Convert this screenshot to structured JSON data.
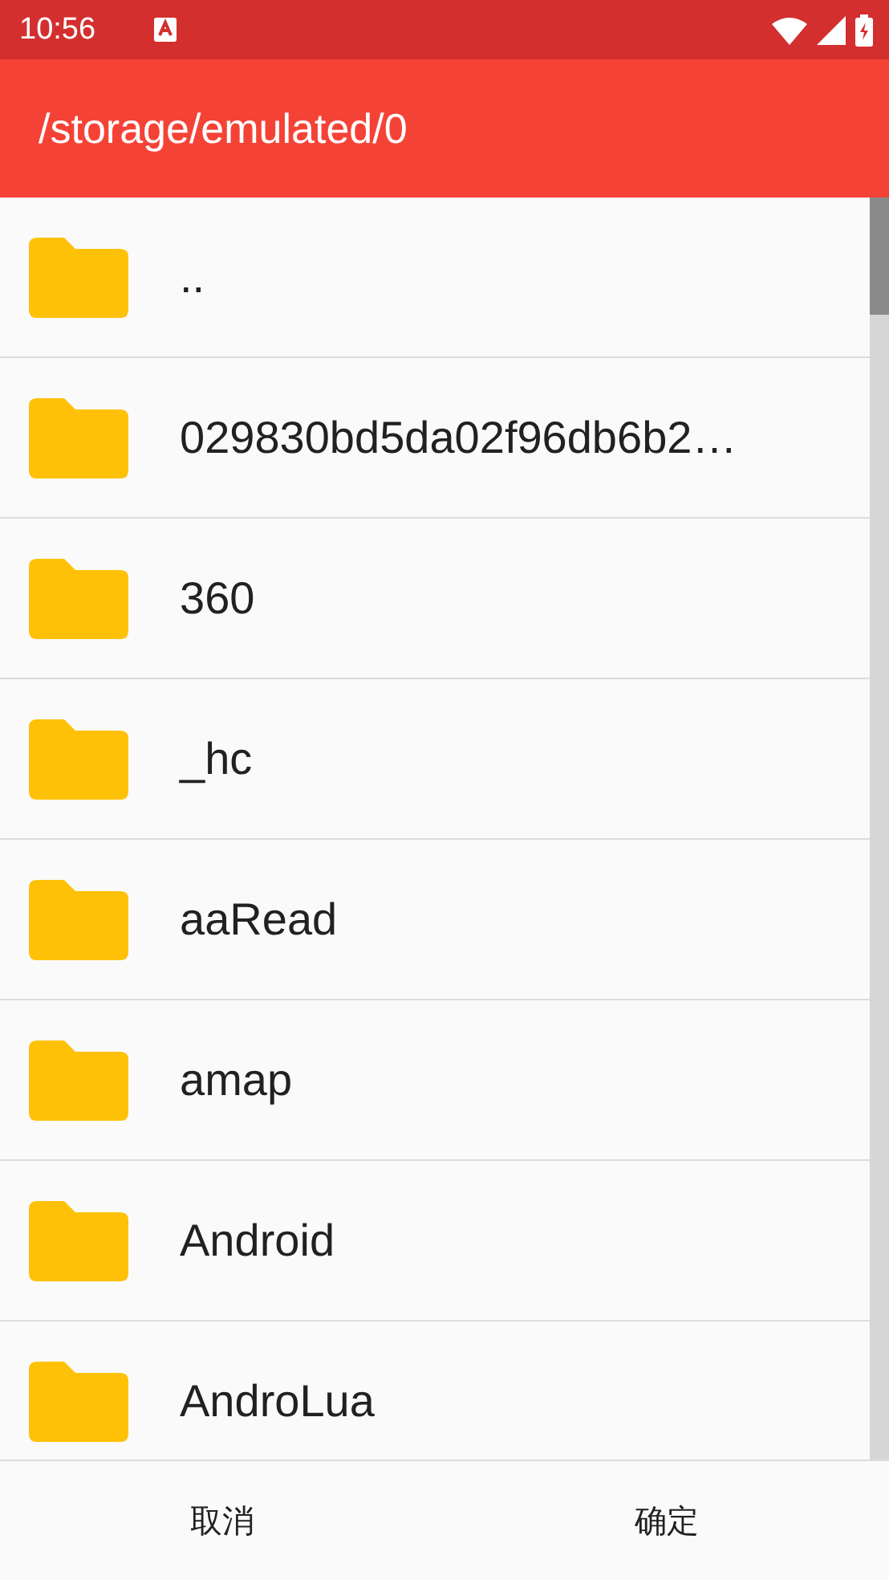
{
  "status_bar": {
    "time": "10:56"
  },
  "toolbar": {
    "title": "/storage/emulated/0"
  },
  "files": [
    {
      "name": ".."
    },
    {
      "name": "029830bd5da02f96db6b2…"
    },
    {
      "name": "360"
    },
    {
      "name": "_hc"
    },
    {
      "name": "aaRead"
    },
    {
      "name": "amap"
    },
    {
      "name": "Android"
    },
    {
      "name": "AndroLua"
    }
  ],
  "buttons": [
    "取消",
    "确定"
  ]
}
